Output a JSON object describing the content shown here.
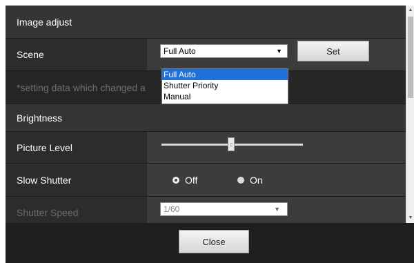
{
  "image_adjust": {
    "title": "Image adjust",
    "scene": {
      "label": "Scene",
      "selected": "Full Auto",
      "options": [
        "Full Auto",
        "Shutter Priority",
        "Manual"
      ],
      "set_label": "Set"
    },
    "note": "*setting data which changed a"
  },
  "brightness": {
    "title": "Brightness",
    "picture_level": {
      "label": "Picture Level",
      "level": 0.5
    },
    "slow_shutter": {
      "label": "Slow Shutter",
      "off_label": "Off",
      "on_label": "On",
      "selected": "Off"
    },
    "shutter_speed": {
      "label": "Shutter Speed",
      "value": "1/60"
    }
  },
  "footer": {
    "close_label": "Close"
  },
  "icons": {
    "dropdown": "chevron-down-icon",
    "scroll_up": "arrow-up-icon",
    "scroll_down": "arrow-down-icon"
  }
}
